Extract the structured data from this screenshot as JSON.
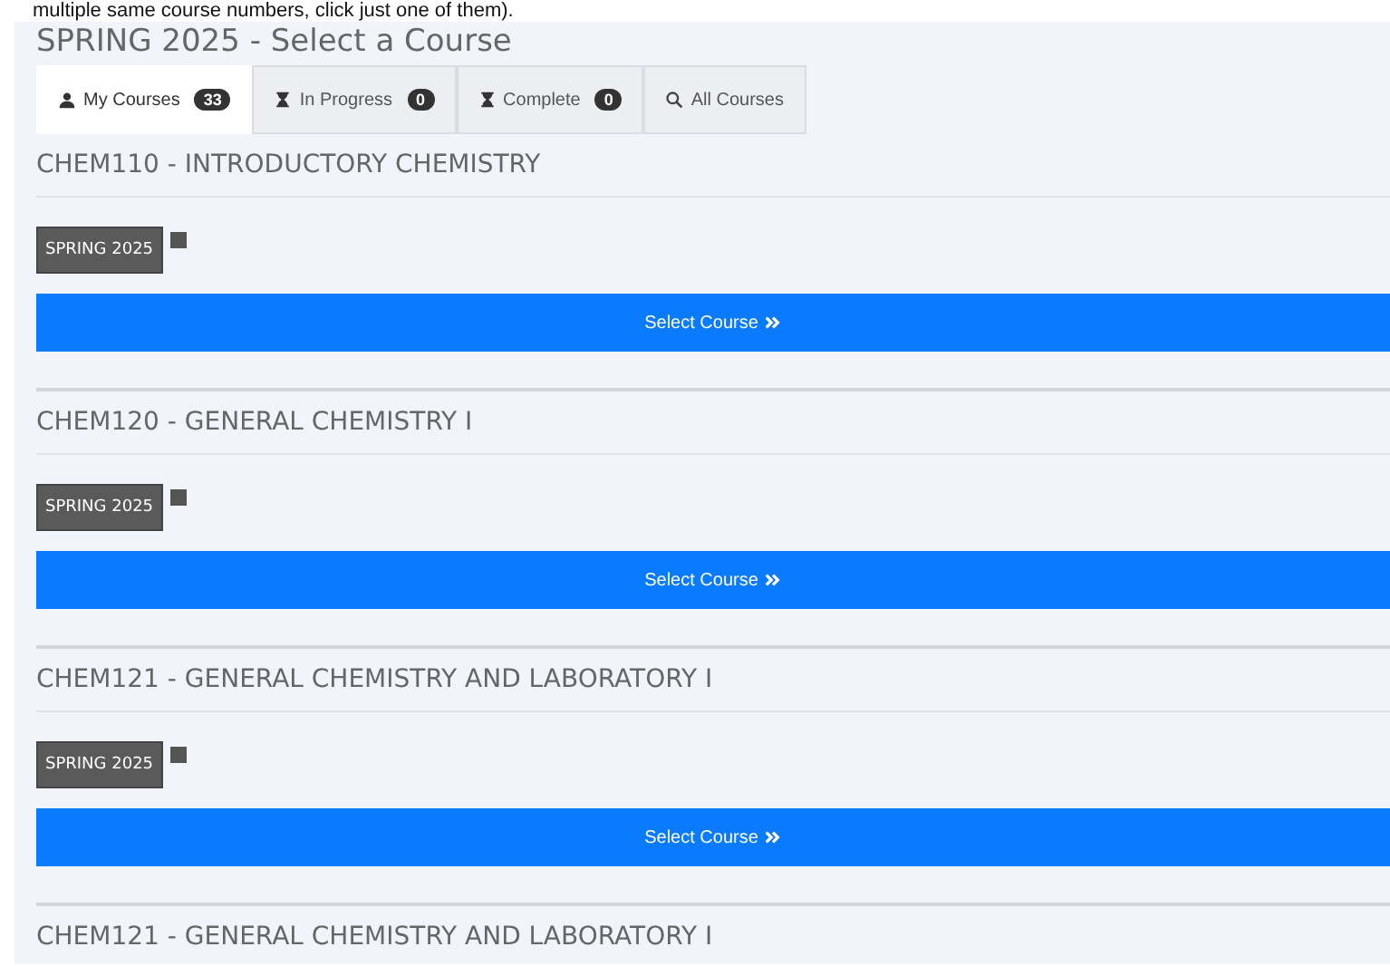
{
  "note": "multiple same course numbers, click just one of them).",
  "title": "SPRING 2025 - Select a Course",
  "tabs": [
    {
      "kind": "user",
      "label": "My Courses",
      "count": "33",
      "selected": true
    },
    {
      "kind": "hourglass",
      "label": "In Progress",
      "count": "0",
      "selected": false
    },
    {
      "kind": "hourglass",
      "label": "Complete",
      "count": "0",
      "selected": false
    },
    {
      "kind": "search",
      "label": "All Courses",
      "selected": false
    }
  ],
  "courses": [
    {
      "title": "CHEM110 - INTRODUCTORY CHEMISTRY",
      "term": "SPRING 2025",
      "button": "Select Course"
    },
    {
      "title": "CHEM120 - GENERAL CHEMISTRY I",
      "term": "SPRING 2025",
      "button": "Select Course"
    },
    {
      "title": "CHEM121 - GENERAL CHEMISTRY AND LABORATORY I",
      "term": "SPRING 2025",
      "button": "Select Course"
    },
    {
      "title": "CHEM121 - GENERAL CHEMISTRY AND LABORATORY I"
    }
  ]
}
